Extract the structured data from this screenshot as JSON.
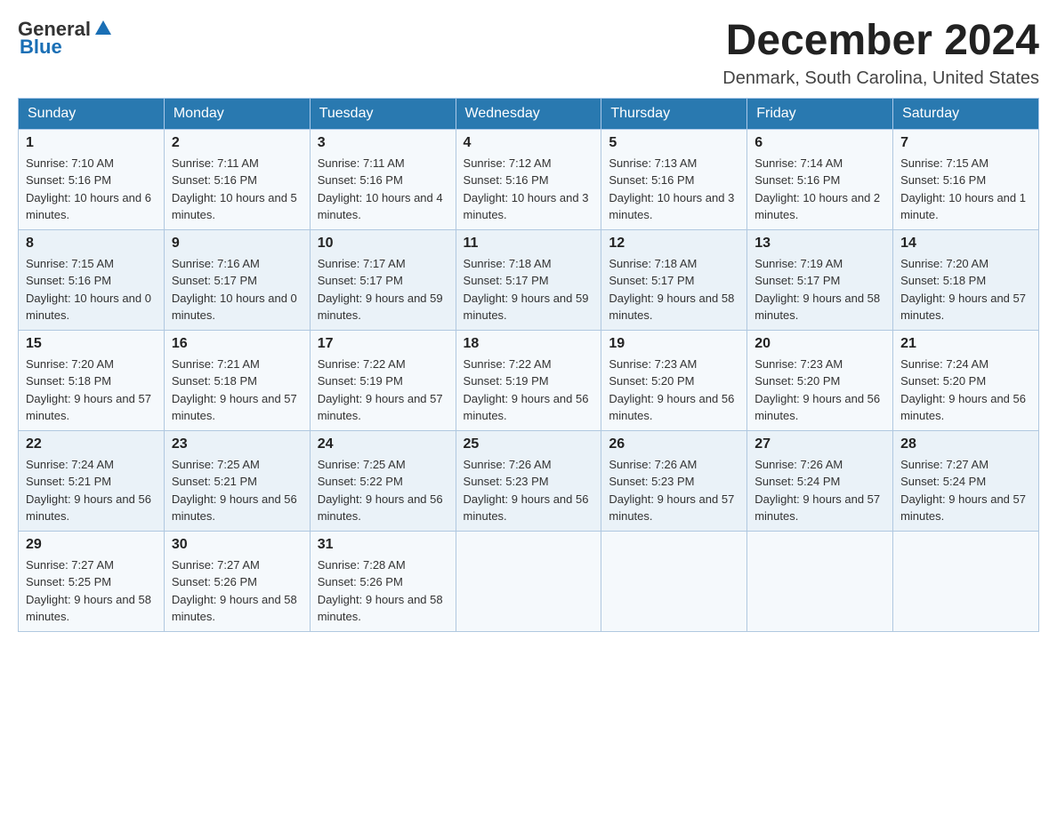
{
  "header": {
    "logo": {
      "general": "General",
      "blue": "Blue",
      "icon": "▲"
    },
    "title": "December 2024",
    "location": "Denmark, South Carolina, United States"
  },
  "calendar": {
    "days_of_week": [
      "Sunday",
      "Monday",
      "Tuesday",
      "Wednesday",
      "Thursday",
      "Friday",
      "Saturday"
    ],
    "weeks": [
      [
        {
          "day": "1",
          "sunrise": "7:10 AM",
          "sunset": "5:16 PM",
          "daylight": "10 hours and 6 minutes."
        },
        {
          "day": "2",
          "sunrise": "7:11 AM",
          "sunset": "5:16 PM",
          "daylight": "10 hours and 5 minutes."
        },
        {
          "day": "3",
          "sunrise": "7:11 AM",
          "sunset": "5:16 PM",
          "daylight": "10 hours and 4 minutes."
        },
        {
          "day": "4",
          "sunrise": "7:12 AM",
          "sunset": "5:16 PM",
          "daylight": "10 hours and 3 minutes."
        },
        {
          "day": "5",
          "sunrise": "7:13 AM",
          "sunset": "5:16 PM",
          "daylight": "10 hours and 3 minutes."
        },
        {
          "day": "6",
          "sunrise": "7:14 AM",
          "sunset": "5:16 PM",
          "daylight": "10 hours and 2 minutes."
        },
        {
          "day": "7",
          "sunrise": "7:15 AM",
          "sunset": "5:16 PM",
          "daylight": "10 hours and 1 minute."
        }
      ],
      [
        {
          "day": "8",
          "sunrise": "7:15 AM",
          "sunset": "5:16 PM",
          "daylight": "10 hours and 0 minutes."
        },
        {
          "day": "9",
          "sunrise": "7:16 AM",
          "sunset": "5:17 PM",
          "daylight": "10 hours and 0 minutes."
        },
        {
          "day": "10",
          "sunrise": "7:17 AM",
          "sunset": "5:17 PM",
          "daylight": "9 hours and 59 minutes."
        },
        {
          "day": "11",
          "sunrise": "7:18 AM",
          "sunset": "5:17 PM",
          "daylight": "9 hours and 59 minutes."
        },
        {
          "day": "12",
          "sunrise": "7:18 AM",
          "sunset": "5:17 PM",
          "daylight": "9 hours and 58 minutes."
        },
        {
          "day": "13",
          "sunrise": "7:19 AM",
          "sunset": "5:17 PM",
          "daylight": "9 hours and 58 minutes."
        },
        {
          "day": "14",
          "sunrise": "7:20 AM",
          "sunset": "5:18 PM",
          "daylight": "9 hours and 57 minutes."
        }
      ],
      [
        {
          "day": "15",
          "sunrise": "7:20 AM",
          "sunset": "5:18 PM",
          "daylight": "9 hours and 57 minutes."
        },
        {
          "day": "16",
          "sunrise": "7:21 AM",
          "sunset": "5:18 PM",
          "daylight": "9 hours and 57 minutes."
        },
        {
          "day": "17",
          "sunrise": "7:22 AM",
          "sunset": "5:19 PM",
          "daylight": "9 hours and 57 minutes."
        },
        {
          "day": "18",
          "sunrise": "7:22 AM",
          "sunset": "5:19 PM",
          "daylight": "9 hours and 56 minutes."
        },
        {
          "day": "19",
          "sunrise": "7:23 AM",
          "sunset": "5:20 PM",
          "daylight": "9 hours and 56 minutes."
        },
        {
          "day": "20",
          "sunrise": "7:23 AM",
          "sunset": "5:20 PM",
          "daylight": "9 hours and 56 minutes."
        },
        {
          "day": "21",
          "sunrise": "7:24 AM",
          "sunset": "5:20 PM",
          "daylight": "9 hours and 56 minutes."
        }
      ],
      [
        {
          "day": "22",
          "sunrise": "7:24 AM",
          "sunset": "5:21 PM",
          "daylight": "9 hours and 56 minutes."
        },
        {
          "day": "23",
          "sunrise": "7:25 AM",
          "sunset": "5:21 PM",
          "daylight": "9 hours and 56 minutes."
        },
        {
          "day": "24",
          "sunrise": "7:25 AM",
          "sunset": "5:22 PM",
          "daylight": "9 hours and 56 minutes."
        },
        {
          "day": "25",
          "sunrise": "7:26 AM",
          "sunset": "5:23 PM",
          "daylight": "9 hours and 56 minutes."
        },
        {
          "day": "26",
          "sunrise": "7:26 AM",
          "sunset": "5:23 PM",
          "daylight": "9 hours and 57 minutes."
        },
        {
          "day": "27",
          "sunrise": "7:26 AM",
          "sunset": "5:24 PM",
          "daylight": "9 hours and 57 minutes."
        },
        {
          "day": "28",
          "sunrise": "7:27 AM",
          "sunset": "5:24 PM",
          "daylight": "9 hours and 57 minutes."
        }
      ],
      [
        {
          "day": "29",
          "sunrise": "7:27 AM",
          "sunset": "5:25 PM",
          "daylight": "9 hours and 58 minutes."
        },
        {
          "day": "30",
          "sunrise": "7:27 AM",
          "sunset": "5:26 PM",
          "daylight": "9 hours and 58 minutes."
        },
        {
          "day": "31",
          "sunrise": "7:28 AM",
          "sunset": "5:26 PM",
          "daylight": "9 hours and 58 minutes."
        },
        null,
        null,
        null,
        null
      ]
    ]
  }
}
